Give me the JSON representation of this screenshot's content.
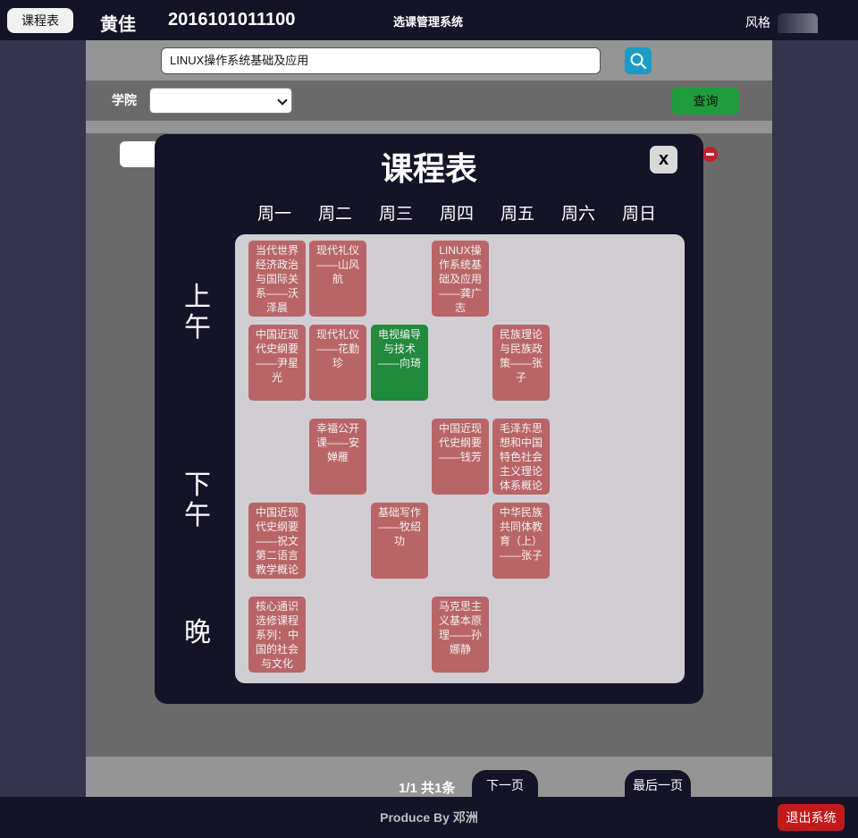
{
  "topbar": {
    "schedule_button": "课程表",
    "student_name": "黄佳",
    "student_id": "2016101011100",
    "system_title": "选课管理系统",
    "style_label": "风格"
  },
  "search": {
    "value": "LINUX操作系统基础及应用",
    "icon": "search-icon"
  },
  "filter": {
    "college_label": "学院",
    "college_value": "",
    "query_button": "查询"
  },
  "pager": {
    "info": "1/1 共1条",
    "next": "下一页",
    "last": "最后一页"
  },
  "footer": {
    "text": "Produce By 邓洲",
    "exit_button": "退出系统"
  },
  "modal": {
    "title": "课程表",
    "close": "x",
    "days": [
      "周一",
      "周二",
      "周三",
      "周四",
      "周五",
      "周六",
      "周日"
    ],
    "periods": {
      "morning": "上午",
      "afternoon": "下午",
      "evening": "晚"
    },
    "courses": {
      "mon_1": "当代世界经济政治与国际关系——沃泽晨",
      "tue_1": "现代礼仪——山风航",
      "thu_1": "LINUX操作系统基础及应用——龚广志",
      "mon_2": "中国近现代史纲要——尹星光",
      "tue_2": "现代礼仪——花勤珍",
      "wed_2": "电视编导与技术——向琦",
      "fri_2": "民族理论与民族政策——张子",
      "tue_3": "幸福公开课——安婵雁",
      "thu_3": "中国近现代史纲要——钱芳",
      "fri_3": "毛泽东思想和中国特色社会主义理论体系概论",
      "mon_4": "中国近现代史纲要——祝文第二语言教学概论",
      "wed_4": "基础写作——牧绍功",
      "fri_4": "中华民族共同体教育（上）——张子",
      "mon_5": "核心通识选修课程系列：中国的社会与文化",
      "thu_5": "马克思主义基本原理——孙娜静"
    }
  },
  "colors": {
    "course": "#b96567",
    "selected_course": "#218a3c",
    "accent": "#1a9cc4",
    "query": "#1f9c3c",
    "exit": "#c11a1a"
  }
}
